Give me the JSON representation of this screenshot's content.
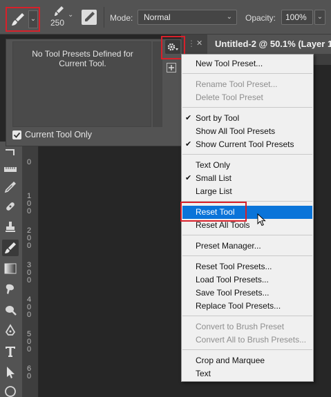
{
  "options_bar": {
    "brush_size": "250",
    "mode_label": "Mode:",
    "mode_value": "Normal",
    "opacity_label": "Opacity:",
    "opacity_value": "100%",
    "icons": [
      "brush-icon",
      "chevron-down-icon",
      "brush-size-icon",
      "airbrush-icon"
    ]
  },
  "document_tab": {
    "title": "Untitled-2 @ 50.1% (Layer 1"
  },
  "presets_panel": {
    "empty_message_line1": "No Tool Presets Defined for",
    "empty_message_line2": "Current Tool.",
    "current_tool_only_label": "Current Tool Only",
    "current_tool_only_checked": true
  },
  "ruler": {
    "numbers": [
      "0",
      "1",
      "0",
      "0",
      "2",
      "0",
      "0",
      "3",
      "0",
      "0",
      "4",
      "0",
      "0",
      "5",
      "0",
      "0",
      "6",
      "0"
    ]
  },
  "menu": {
    "new_tool_preset": "New Tool Preset...",
    "rename_tool_preset": "Rename Tool Preset...",
    "delete_tool_preset": "Delete Tool Preset",
    "sort_by_tool": "Sort by Tool",
    "show_all_tool_presets": "Show All Tool Presets",
    "show_current_tool_presets": "Show Current Tool Presets",
    "text_only": "Text Only",
    "small_list": "Small List",
    "large_list": "Large List",
    "reset_tool": "Reset Tool",
    "reset_all_tools": "Reset All Tools",
    "preset_manager": "Preset Manager...",
    "reset_tool_presets": "Reset Tool Presets...",
    "load_tool_presets": "Load Tool Presets...",
    "save_tool_presets": "Save Tool Presets...",
    "replace_tool_presets": "Replace Tool Presets...",
    "convert_to_brush_preset": "Convert to Brush Preset",
    "convert_all_to_brush_presets": "Convert All to Brush Presets...",
    "crop_and_marquee": "Crop and Marquee",
    "text": "Text",
    "checkmark": "✔"
  },
  "colors": {
    "highlight_red": "#d8202a",
    "menu_hover_blue": "#0a74d9",
    "panel_gray": "#535353"
  }
}
